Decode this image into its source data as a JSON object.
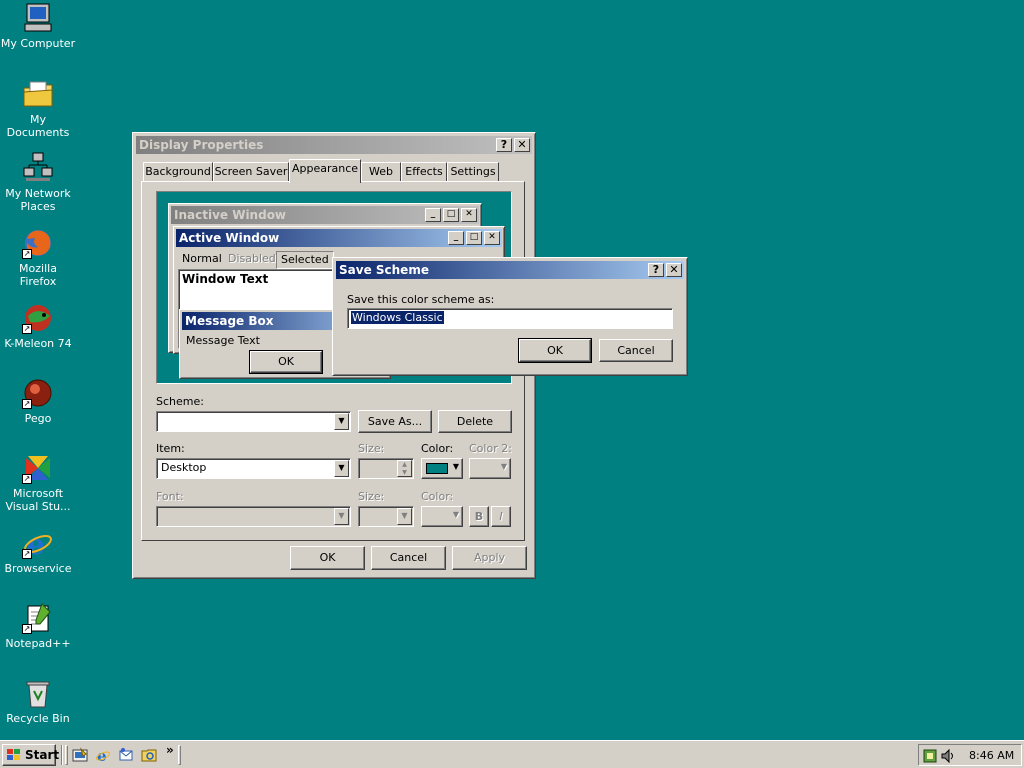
{
  "desktop": {
    "bg_color": "#008080",
    "icons": [
      {
        "label": "My Computer",
        "icon": "computer-icon",
        "shortcut": false
      },
      {
        "label": "My Documents",
        "icon": "folder-icon",
        "shortcut": false
      },
      {
        "label": "My Network Places",
        "icon": "network-icon",
        "shortcut": false
      },
      {
        "label": "Mozilla Firefox",
        "icon": "firefox-icon",
        "shortcut": true
      },
      {
        "label": "K-Meleon 74",
        "icon": "kmeleon-icon",
        "shortcut": true
      },
      {
        "label": "Pego",
        "icon": "pego-icon",
        "shortcut": true
      },
      {
        "label": "Microsoft Visual Stu...",
        "icon": "visual-studio-icon",
        "shortcut": true
      },
      {
        "label": "Browservice",
        "icon": "ie-icon",
        "shortcut": true
      },
      {
        "label": "Notepad++",
        "icon": "notepad-icon",
        "shortcut": true
      },
      {
        "label": "Recycle Bin",
        "icon": "recycle-bin-icon",
        "shortcut": false
      }
    ]
  },
  "display_properties": {
    "title": "Display Properties",
    "help": "?",
    "close": "✕",
    "tabs": [
      "Background",
      "Screen Saver",
      "Appearance",
      "Web",
      "Effects",
      "Settings"
    ],
    "active_tab": "Appearance",
    "preview": {
      "inactive_title": "Inactive Window",
      "active_title": "Active Window",
      "menu": {
        "normal": "Normal",
        "disabled": "Disabled",
        "selected": "Selected"
      },
      "window_text": "Window Text",
      "message_box_title": "Message Box",
      "message_text": "Message Text",
      "ok": "OK"
    },
    "scheme_label": "Scheme:",
    "scheme_value": "",
    "save_as": "Save As...",
    "delete": "Delete",
    "item_label": "Item:",
    "item_value": "Desktop",
    "size_label": "Size:",
    "color_label": "Color:",
    "color2_label": "Color 2:",
    "font_label": "Font:",
    "font_size_label": "Size:",
    "font_color_label": "Color:",
    "bold": "B",
    "italic": "I",
    "ok": "OK",
    "cancel": "Cancel",
    "apply": "Apply",
    "item_color": "#008080"
  },
  "save_scheme": {
    "title": "Save Scheme",
    "help": "?",
    "close": "✕",
    "prompt": "Save this color scheme as:",
    "value": "Windows Classic",
    "ok": "OK",
    "cancel": "Cancel"
  },
  "taskbar": {
    "start": "Start",
    "chevron": "»",
    "quick_launch": [
      "show-desktop-icon",
      "ie-icon",
      "outlook-icon",
      "explorer-icon"
    ],
    "clock": "8:46 AM"
  }
}
